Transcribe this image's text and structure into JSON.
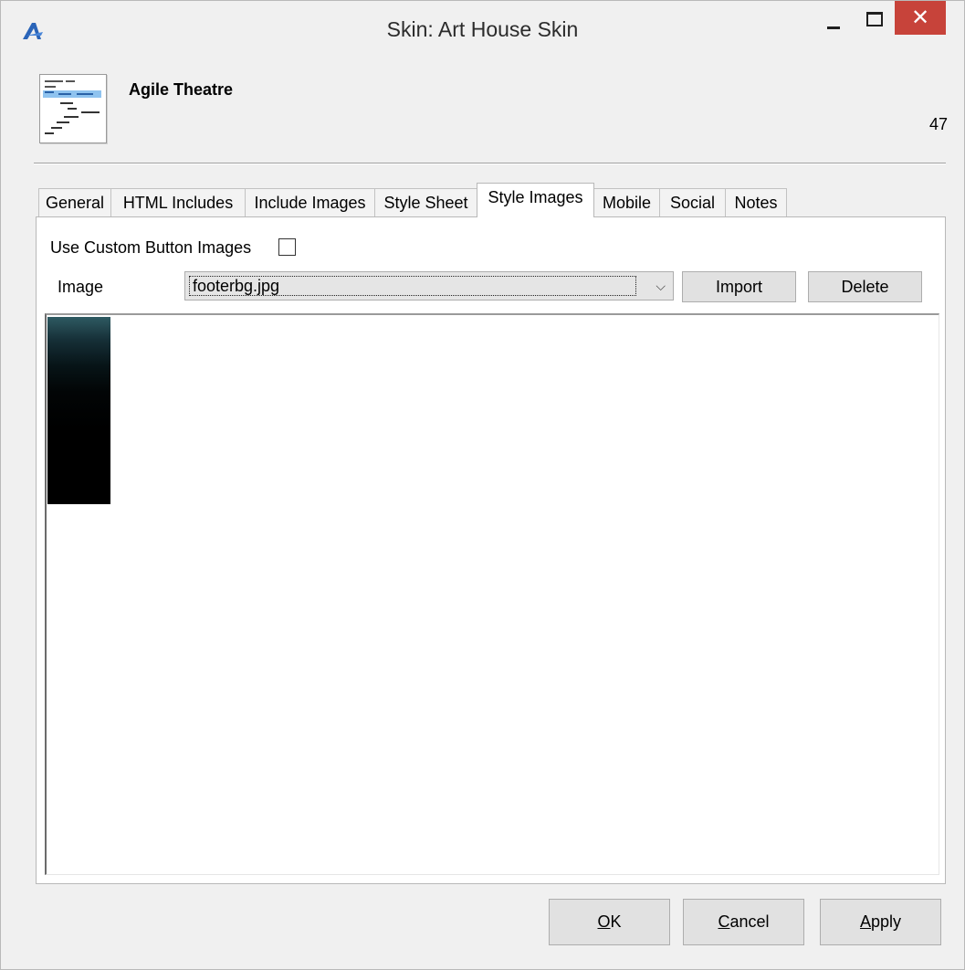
{
  "window": {
    "title": "Skin: Art House Skin",
    "close_glyph": "✕"
  },
  "header": {
    "title": "Agile Theatre",
    "number": "47"
  },
  "tabs": [
    {
      "label": "General"
    },
    {
      "label": "HTML Includes"
    },
    {
      "label": "Include Images"
    },
    {
      "label": "Style Sheet"
    },
    {
      "label": "Style Images",
      "active": true
    },
    {
      "label": "Mobile"
    },
    {
      "label": "Social"
    },
    {
      "label": "Notes"
    }
  ],
  "style_images": {
    "use_custom_label": "Use Custom Button Images",
    "use_custom_checked": false,
    "image_label": "Image",
    "image_value": "footerbg.jpg",
    "import_label": "Import",
    "delete_label": "Delete"
  },
  "footer": {
    "ok_rest": "K",
    "ok_accel": "O",
    "cancel_accel": "C",
    "cancel_rest": "ancel",
    "apply_accel": "A",
    "apply_rest": "pply"
  },
  "colors": {
    "close_button": "#c7433a",
    "app_icon": "#2a64b8"
  },
  "icons": [
    "app-logo-icon",
    "minimize-icon",
    "maximize-icon",
    "close-icon",
    "skin-document-icon",
    "chevron-down-icon"
  ]
}
